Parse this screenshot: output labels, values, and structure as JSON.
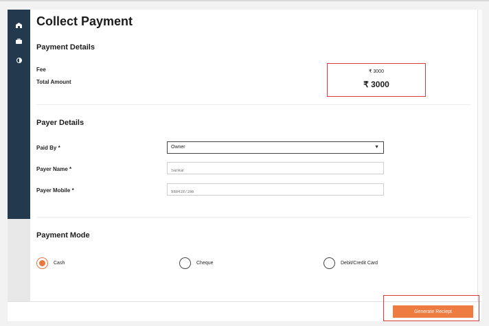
{
  "page": {
    "title": "Collect Payment"
  },
  "sidebar": {
    "icons": [
      {
        "name": "home-icon"
      },
      {
        "name": "briefcase-icon"
      },
      {
        "name": "contrast-icon"
      }
    ]
  },
  "payment_details": {
    "heading": "Payment Details",
    "fee_label": "Fee",
    "fee_value": "₹ 3000",
    "total_label": "Total Amount",
    "total_value": "₹ 3000"
  },
  "payer_details": {
    "heading": "Payer Details",
    "paid_by_label": "Paid By *",
    "paid_by_value": "Owner",
    "payer_name_label": "Payer Name *",
    "payer_name_placeholder": "Sankar",
    "payer_mobile_label": "Payer Mobile *",
    "payer_mobile_placeholder": "9884187166"
  },
  "payment_mode": {
    "heading": "Payment Mode",
    "options": [
      {
        "label": "Cash",
        "selected": true
      },
      {
        "label": "Cheque",
        "selected": false
      },
      {
        "label": "Debit/Credit Card",
        "selected": false
      }
    ]
  },
  "actions": {
    "generate_label": "Generate Reciept"
  },
  "colors": {
    "accent": "#ee7b40",
    "sidebar": "#233a4e",
    "highlight": "#d9393b"
  }
}
